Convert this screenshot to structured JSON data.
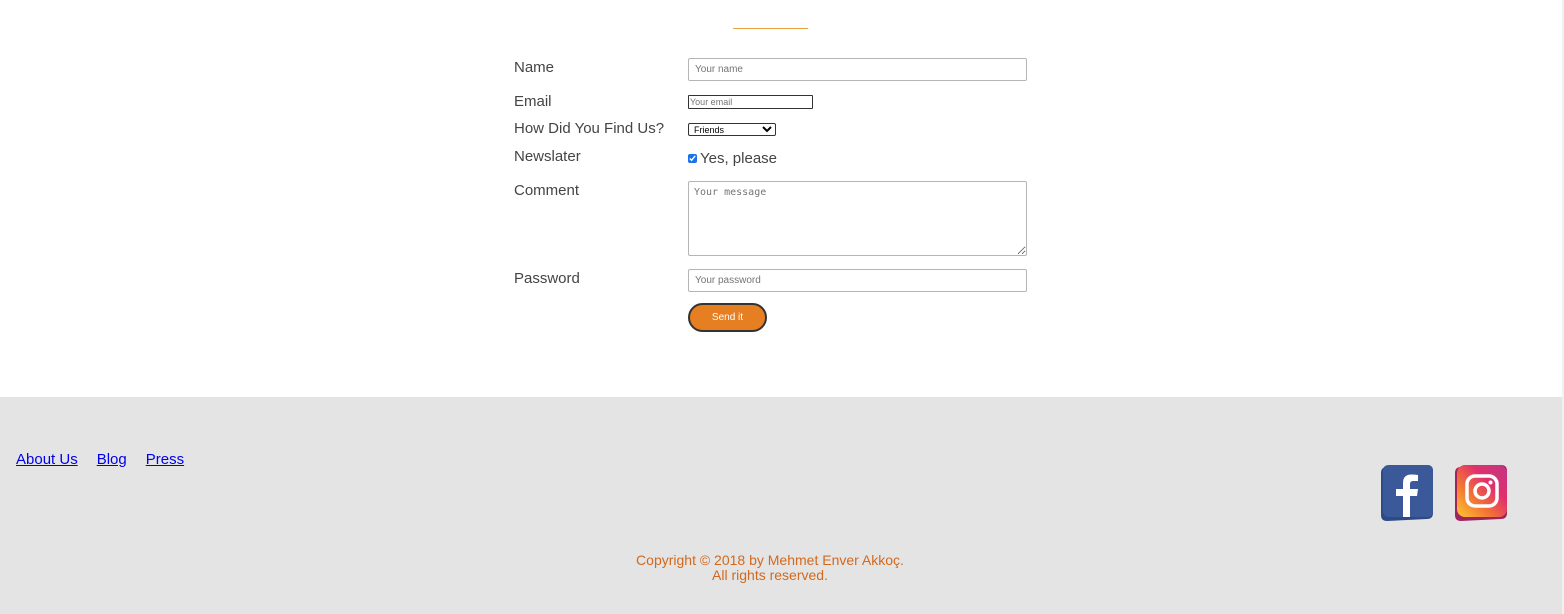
{
  "form": {
    "name_label": "Name",
    "name_placeholder": "Your name",
    "email_label": "Email",
    "email_placeholder": "Your email",
    "source_label": "How Did You Find Us?",
    "source_selected": "Friends",
    "newsletter_label": "Newslater",
    "newsletter_checkbox_label": "Yes, please",
    "newsletter_checked": true,
    "comment_label": "Comment",
    "comment_placeholder": "Your message",
    "password_label": "Password",
    "password_placeholder": "Your password",
    "submit_label": "Send it"
  },
  "footer": {
    "links": [
      {
        "label": "About Us"
      },
      {
        "label": "Blog"
      },
      {
        "label": "Press"
      }
    ],
    "copyright_line1": "Copyright © 2018 by Mehmet Enver Akkoç.",
    "copyright_line2": "All rights reserved.",
    "social": [
      {
        "icon": "facebook-icon"
      },
      {
        "icon": "instagram-icon"
      }
    ]
  },
  "colors": {
    "accent": "#e67e22",
    "footer_bg": "#e4e4e4",
    "copyright_text": "#d2691e",
    "link": "#0000ee"
  }
}
